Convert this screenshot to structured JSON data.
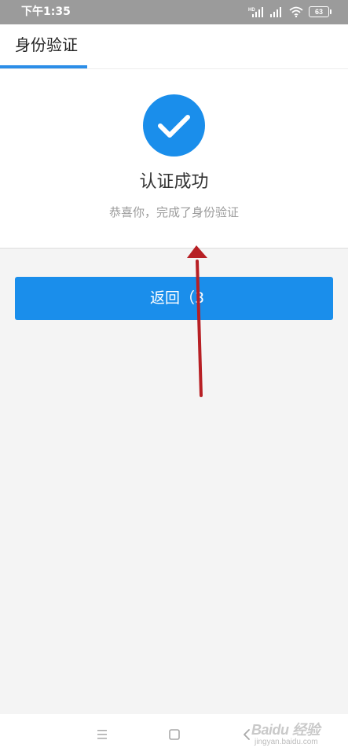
{
  "status_bar": {
    "time": "下午1:35",
    "battery": "63",
    "icons": [
      "hd-signal-icon",
      "signal-icon",
      "wifi-icon",
      "battery-icon"
    ]
  },
  "header": {
    "title": "身份验证"
  },
  "result": {
    "icon": "check-circle-icon",
    "title": "认证成功",
    "subtitle": "恭喜你，完成了身份验证"
  },
  "actions": {
    "back_label": "返回（3"
  },
  "nav_bar": {
    "icons": [
      "menu-icon",
      "home-icon",
      "back-icon"
    ]
  },
  "watermark": {
    "brand": "Baidu 经验",
    "url": "jingyan.baidu.com"
  },
  "colors": {
    "accent": "#1a8eeb",
    "status_bar": "#9b9b9b",
    "annotation": "#b71f24"
  }
}
